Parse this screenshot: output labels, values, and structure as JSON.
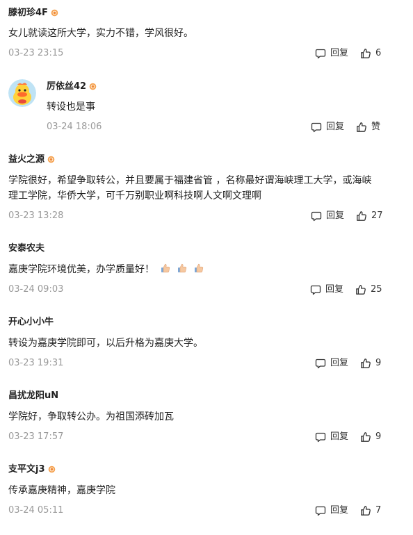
{
  "comments": [
    {
      "user": "滕初珍4F",
      "badge": true,
      "text": "女儿就读这所大学，实力不错，学风很好。",
      "time": "03-23 23:15",
      "reply": "回复",
      "likes": "6"
    },
    {
      "user": "厉依丝42",
      "badge": true,
      "avatar": "duck-avatar",
      "text": "转设也是事",
      "time": "03-24 18:06",
      "reply": "回复",
      "likes": "赞"
    },
    {
      "user": "益火之源",
      "badge": true,
      "text_line1": "学院很好，希望争取转公，并且要属于福建省管 ，名称最好谓海峡理工大学，或海峡",
      "text_line2": "理工学院，华侨大学，可千万别职业啊科技啊人文啊文理啊",
      "time": "03-23 13:28",
      "reply": "回复",
      "likes": "27"
    },
    {
      "user": "安泰农夫",
      "badge": false,
      "text": "嘉庚学院环境优美，办学质量好！",
      "emojis": [
        "thumbs-up-emoji",
        "thumbs-up-emoji",
        "thumbs-up-emoji"
      ],
      "time": "03-24 09:03",
      "reply": "回复",
      "likes": "25"
    },
    {
      "user": "开心小小牛",
      "badge": false,
      "text": "转设为嘉庚学院即可，以后升格为嘉庚大学。",
      "time": "03-23 19:31",
      "reply": "回复",
      "likes": "9"
    },
    {
      "user": "昌扰龙阳uN",
      "badge": false,
      "text": "学院好，争取转公办。为祖国添砖加瓦",
      "time": "03-23 17:57",
      "reply": "回复",
      "likes": "9"
    },
    {
      "user": "支平文j3",
      "badge": true,
      "text": "传承嘉庚精神，嘉庚学院",
      "time": "03-24 05:11",
      "reply": "回复",
      "likes": "7"
    }
  ],
  "colors": {
    "badge": "#f08a3a",
    "time": "#999999",
    "text": "#222222"
  },
  "icons": {
    "reply": "comment-bubble-icon",
    "like": "thumbs-up-icon",
    "badge": "level-badge-icon"
  }
}
